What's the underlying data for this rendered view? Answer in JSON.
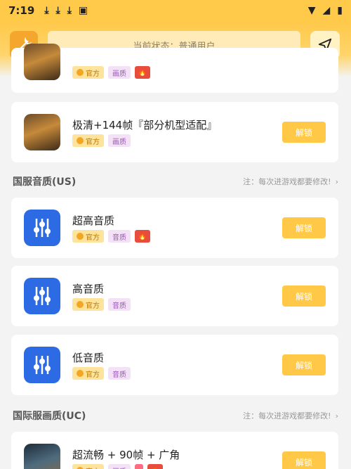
{
  "statusbar": {
    "time": "7:19",
    "icons": [
      "download-icon",
      "download-icon",
      "download-icon",
      "app-icon"
    ]
  },
  "header": {
    "status_text": "当前状态：普通用户"
  },
  "common": {
    "official": "官方",
    "unlock": "解锁",
    "note": "注：每次进游戏都要修改!"
  },
  "cards": [
    {
      "title": "",
      "tags": [
        "官方",
        "画质"
      ]
    },
    {
      "title": "极清+144帧『部分机型适配』",
      "tags": [
        "官方",
        "画质"
      ]
    },
    {
      "title": "超高音质",
      "tags": [
        "官方",
        "音质"
      ]
    },
    {
      "title": "高音质",
      "tags": [
        "官方",
        "音质"
      ]
    },
    {
      "title": "低音质",
      "tags": [
        "官方",
        "音质"
      ]
    },
    {
      "title": "超流畅 + 90帧 + 广角",
      "tags": [
        "官方",
        "画质"
      ]
    }
  ],
  "sections": [
    {
      "title": "国服音质(US)"
    },
    {
      "title": "国际服画质(UC)"
    }
  ]
}
